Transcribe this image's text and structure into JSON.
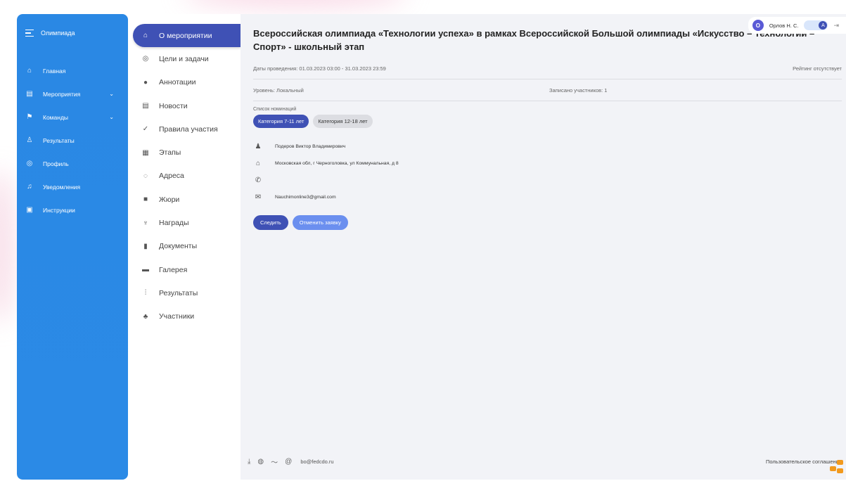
{
  "sidebar": {
    "brand": "Олимпиада",
    "items": [
      {
        "label": "Главная",
        "icon": "home-icon"
      },
      {
        "label": "Мероприятия",
        "icon": "calendar-icon",
        "caret": true
      },
      {
        "label": "Команды",
        "icon": "team-icon",
        "caret": true
      },
      {
        "label": "Результаты",
        "icon": "trophy-icon"
      },
      {
        "label": "Профиль",
        "icon": "profile-icon"
      },
      {
        "label": "Уведомления",
        "icon": "bell-icon"
      },
      {
        "label": "Инструкции",
        "icon": "book-icon"
      }
    ]
  },
  "subnav": {
    "items": [
      {
        "label": "О мероприятии",
        "icon": "home-icon",
        "active": true
      },
      {
        "label": "Цели и задачи",
        "icon": "target-icon"
      },
      {
        "label": "Аннотации",
        "icon": "info-icon"
      },
      {
        "label": "Новости",
        "icon": "news-icon"
      },
      {
        "label": "Правила участия",
        "icon": "check-icon"
      },
      {
        "label": "Этапы",
        "icon": "stages-icon"
      },
      {
        "label": "Адреса",
        "icon": "location-icon"
      },
      {
        "label": "Жюри",
        "icon": "jury-icon"
      },
      {
        "label": "Награды",
        "icon": "award-icon"
      },
      {
        "label": "Документы",
        "icon": "document-icon"
      },
      {
        "label": "Галерея",
        "icon": "gallery-icon"
      },
      {
        "label": "Результаты",
        "icon": "results-chart-icon"
      },
      {
        "label": "Участники",
        "icon": "participants-icon"
      }
    ]
  },
  "event": {
    "title": "Всероссийская олимпиада «Технологии успеха» в рамках Всероссийской Большой олимпиады «Искусство – Технологии – Спорт» - школьный этап",
    "dates": "Даты проведения: 01.03.2023 03:00 - 31.03.2023 23:59",
    "rating": "Рейтинг отсутствует",
    "level": "Уровень: Локальный",
    "participants": "Записано участников: 1",
    "nominations_label": "Список номинаций",
    "nominations": [
      "Категория 7-11 лет",
      "Категория 12-18 лет"
    ],
    "contact_person": "Подеров Виктор Владимирович",
    "address": "Московская обл, г Черноголовка, ул Коммунальная, д 8",
    "phone": "",
    "email": "Nauchimonline3@gmail.com",
    "follow_button": "Следить",
    "cancel_button": "Отменить заявку"
  },
  "user": {
    "initial": "О",
    "name": "Орлов Н. С.",
    "toggle_letter": "A"
  },
  "footer": {
    "email": "bo@fedcdo.ru",
    "agreement": "Пользовательское соглашение"
  },
  "colors": {
    "sidebar": "#2b8ae6",
    "accent": "#3f51b5",
    "secondary_button": "#6b8fef",
    "background": "#f2f3f7"
  }
}
